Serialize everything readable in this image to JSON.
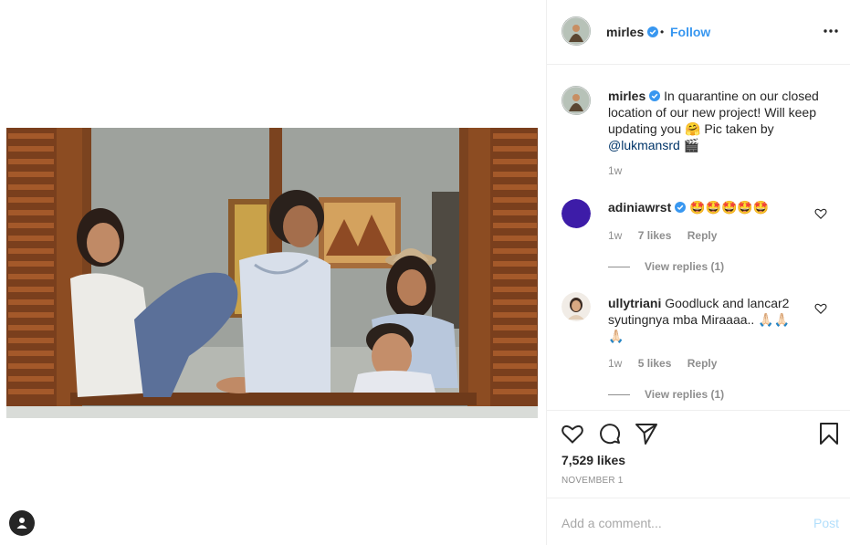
{
  "post": {
    "username": "mirles",
    "verified": true,
    "follow_sep": "•",
    "follow_label": "Follow",
    "more_icon": "more-horizontal-icon"
  },
  "caption": {
    "username": "mirles",
    "text_1": "In quarantine on our closed location of our new project! Will keep updating you",
    "emoji_1": "🤗",
    "text_2": "Pic taken by",
    "mention": "@lukmansrd",
    "emoji_2": "🎬",
    "time": "1w"
  },
  "comments": [
    {
      "username": "adiniawrst",
      "verified": true,
      "text": "🤩🤩🤩🤩🤩",
      "time": "1w",
      "likes": "7 likes",
      "reply_label": "Reply",
      "view_replies": "View replies (1)",
      "avatar_color": "#3d1ca8"
    },
    {
      "username": "ullytriani",
      "verified": false,
      "text": "Goodluck and lancar2 syutingnya mba Miraaaa.. 🙏🏻🙏🏻 🙏🏻",
      "time": "1w",
      "likes": "5 likes",
      "reply_label": "Reply",
      "view_replies": "View replies (1)"
    }
  ],
  "actions": {
    "like_icon": "heart-icon",
    "comment_icon": "comment-bubble-icon",
    "share_icon": "paper-plane-icon",
    "save_icon": "bookmark-icon",
    "likes_count": "7,529 likes",
    "date": "NOVEMBER 1"
  },
  "add_comment": {
    "placeholder": "Add a comment...",
    "post_label": "Post"
  },
  "colors": {
    "link_blue": "#3897f0",
    "verified_blue": "#3897f0",
    "muted_text": "#8e8e8e",
    "post_disabled": "#b2dffc",
    "border": "#efefef"
  }
}
